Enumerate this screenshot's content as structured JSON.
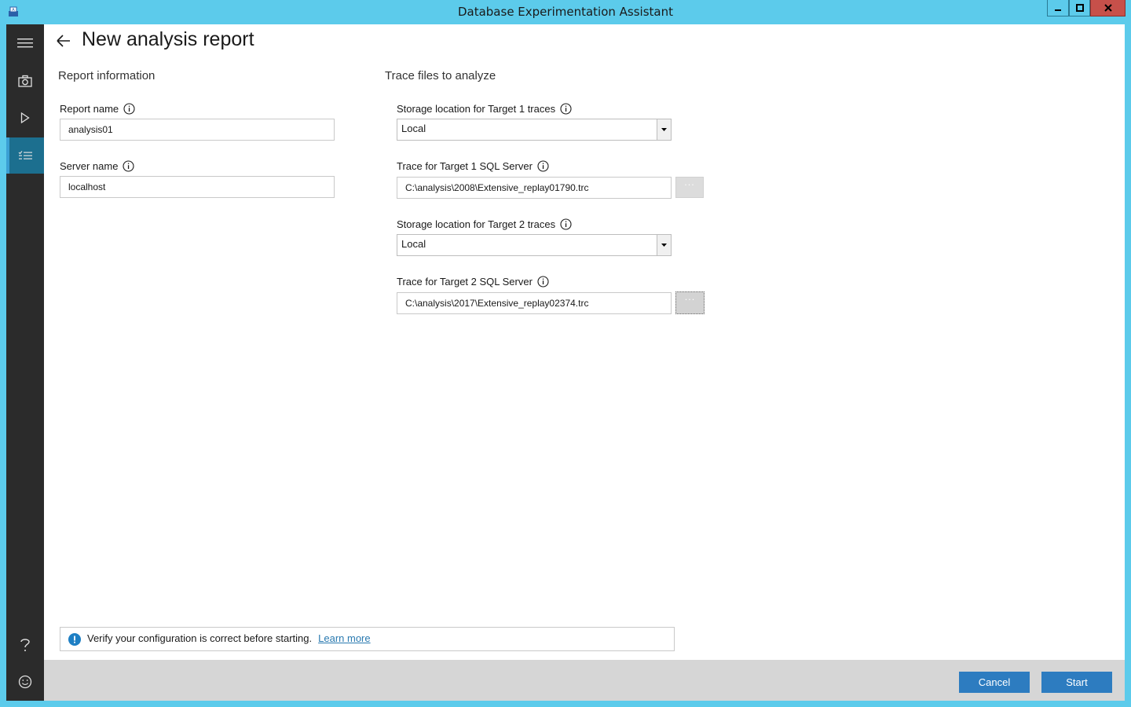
{
  "window": {
    "title": "Database Experimentation Assistant",
    "controls": {
      "minimize": "minimize",
      "maximize": "maximize",
      "close": "close"
    }
  },
  "sidebar": {
    "items": [
      {
        "icon": "hamburger-icon"
      },
      {
        "icon": "camera-icon"
      },
      {
        "icon": "play-icon"
      },
      {
        "icon": "checklist-icon",
        "active": true
      }
    ],
    "bottom": [
      {
        "icon": "help-icon"
      },
      {
        "icon": "smiley-icon"
      }
    ]
  },
  "page": {
    "title": "New analysis report"
  },
  "report_info": {
    "section_title": "Report information",
    "report_name_label": "Report name",
    "report_name_value": "analysis01",
    "server_name_label": "Server name",
    "server_name_value": "localhost"
  },
  "trace_files": {
    "section_title": "Trace files to analyze",
    "target1_storage_label": "Storage location for Target 1 traces",
    "target1_storage_value": "Local",
    "target1_trace_label": "Trace for Target 1 SQL Server",
    "target1_trace_value": "C:\\analysis\\2008\\Extensive_replay01790.trc",
    "target2_storage_label": "Storage location for Target 2 traces",
    "target2_storage_value": "Local",
    "target2_trace_label": "Trace for Target 2 SQL Server",
    "target2_trace_value": "C:\\analysis\\2017\\Extensive_replay02374.trc",
    "browse_label": "···"
  },
  "notice": {
    "message": "Verify your configuration is correct before starting.",
    "link": "Learn more"
  },
  "footer": {
    "cancel_label": "Cancel",
    "start_label": "Start"
  },
  "colors": {
    "titlebar": "#5ccbeb",
    "sidebar": "#2b2b2b",
    "accent_button": "#2d7cc0",
    "active_nav": "#1c6f8f"
  }
}
